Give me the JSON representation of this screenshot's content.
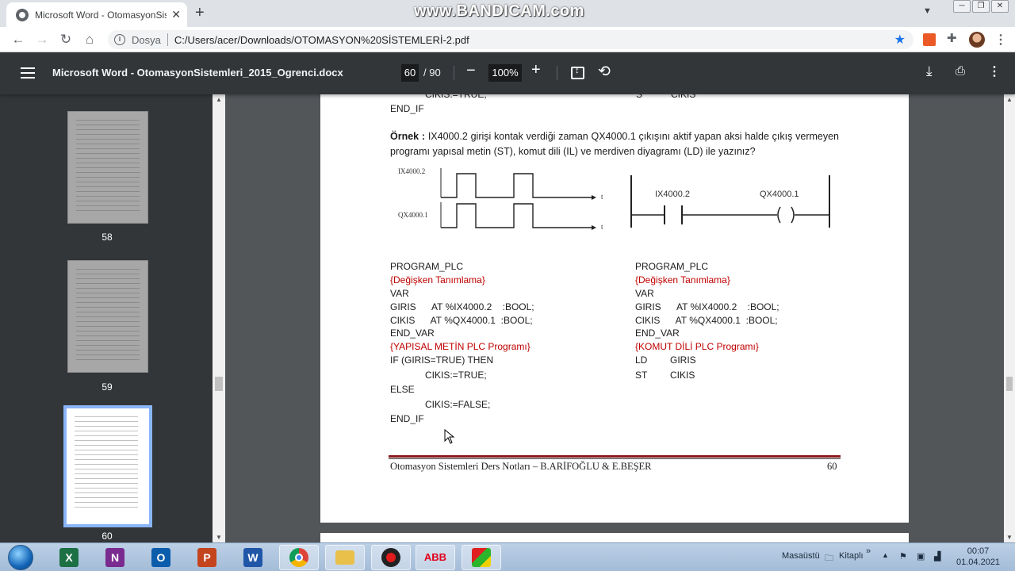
{
  "browser": {
    "tab_title": "Microsoft Word - OtomasyonSistemleri",
    "recorder_watermark": "www.BANDICAM.com",
    "address_scheme": "Dosya",
    "address_url": "C:/Users/acer/Downloads/OTOMASYON%20SİSTEMLERİ-2.pdf"
  },
  "pdf_toolbar": {
    "doc_title": "Microsoft Word - OtomasyonSistemleri_2015_Ogrenci.docx",
    "current_page": "60",
    "total_pages": "/ 90",
    "zoom": "100%"
  },
  "thumbnails": [
    {
      "page": "58",
      "active": false
    },
    {
      "page": "59",
      "active": false
    },
    {
      "page": "60",
      "active": true
    }
  ],
  "page": {
    "top_left_line1": "CIKIS:=TRUE;",
    "top_left_line2": "END_IF",
    "top_right_col1": "S",
    "top_right_col2": "CIKIS",
    "example_label": "Örnek :",
    "example_text": "IX4000.2 girişi kontak verdiği zaman QX4000.1 çıkışını aktif yapan aksi halde çıkış vermeyen programı yapısal metin (ST), komut dili (IL) ve merdiven diyagramı (LD) ile yazınız?",
    "timing": {
      "input_label": "IX4000.2",
      "output_label": "QX4000.1",
      "axis_label": "t"
    },
    "ladder": {
      "contact_label": "IX4000.2",
      "coil_label": "QX4000.1"
    },
    "st_program": {
      "header": "PROGRAM_PLC",
      "comment_vars": "{Değişken Tanımlama}",
      "var": "VAR",
      "giris_decl": "GIRIS      AT %IX4000.2    :BOOL;",
      "cikis_decl": "CIKIS      AT %QX4000.1  :BOOL;",
      "end_var": "END_VAR",
      "comment_prog": "{YAPISAL METİN PLC Programı}",
      "if_line": "IF (GIRIS=TRUE) THEN",
      "then_stmt": "CIKIS:=TRUE;",
      "else": "ELSE",
      "else_stmt": "CIKIS:=FALSE;",
      "end_if": "END_IF"
    },
    "il_program": {
      "header": "PROGRAM_PLC",
      "comment_vars": "{Değişken Tanımlama}",
      "var": "VAR",
      "giris_decl": "GIRIS      AT %IX4000.2    :BOOL;",
      "cikis_decl": "CIKIS      AT %QX4000.1  :BOOL;",
      "end_var": "END_VAR",
      "comment_prog": "{KOMUT DİLİ PLC Programı}",
      "ld_op": "LD",
      "ld_arg": "GIRIS",
      "st_op": "ST",
      "st_arg": "CIKIS"
    },
    "footer_text": "Otomasyon Sistemleri Ders Notları – B.ARİFOĞLU & E.BEŞER",
    "footer_page": "60"
  },
  "taskbar": {
    "apps": [
      "excel",
      "onenote",
      "outlook",
      "powerpoint",
      "word",
      "chrome",
      "file-explorer",
      "bandicam",
      "abb",
      "app-shapes"
    ],
    "desktop_label": "Masaüstü",
    "library_label": "Kitaplı",
    "time": "00:07",
    "date": "01.04.2021"
  }
}
